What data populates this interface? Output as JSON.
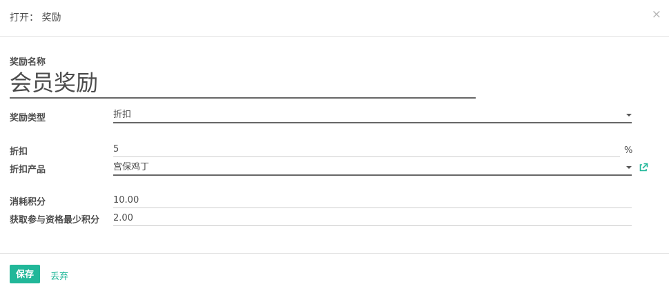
{
  "dialog": {
    "title": "打开： 奖励",
    "close_glyph": "×"
  },
  "form": {
    "reward_name": {
      "label": "奖励名称",
      "value": "会员奖励"
    },
    "reward_type": {
      "label": "奖励类型",
      "value": "折扣"
    },
    "discount": {
      "label": "折扣",
      "value": "5",
      "unit": "%"
    },
    "discount_product": {
      "label": "折扣产品",
      "value": "宫保鸡丁"
    },
    "points_cost": {
      "label": "消耗积分",
      "value": "10.00"
    },
    "min_points": {
      "label": "获取参与资格最少积分",
      "value": "2.00"
    }
  },
  "footer": {
    "save_label": "保存",
    "discard_label": "丢弃"
  },
  "icons": {
    "external_link": "external-link-icon",
    "close": "close-icon",
    "dropdown": "caret-down-icon"
  },
  "colors": {
    "accent": "#21b799",
    "text": "#4c4c4c",
    "divider": "#e2e2e2"
  }
}
